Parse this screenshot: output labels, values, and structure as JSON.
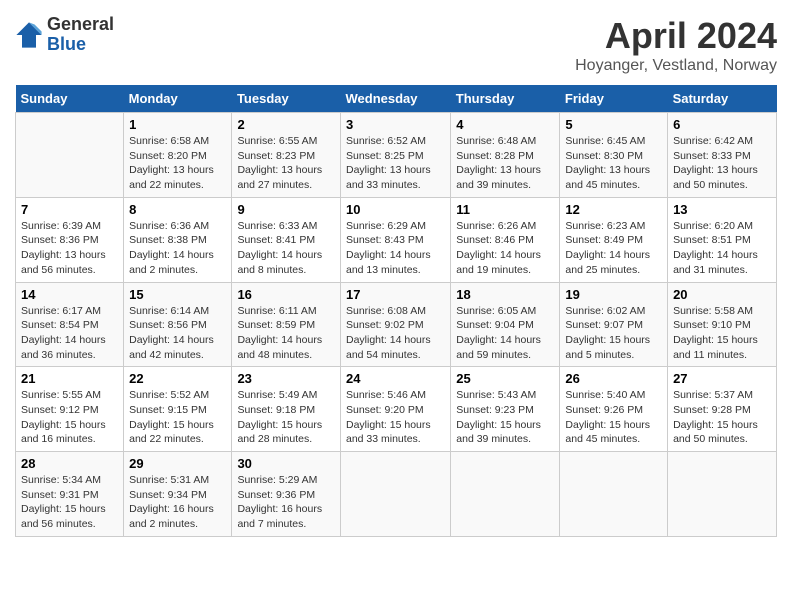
{
  "logo": {
    "general": "General",
    "blue": "Blue"
  },
  "title": "April 2024",
  "subtitle": "Hoyanger, Vestland, Norway",
  "days_header": [
    "Sunday",
    "Monday",
    "Tuesday",
    "Wednesday",
    "Thursday",
    "Friday",
    "Saturday"
  ],
  "weeks": [
    [
      {
        "day": "",
        "detail": ""
      },
      {
        "day": "1",
        "detail": "Sunrise: 6:58 AM\nSunset: 8:20 PM\nDaylight: 13 hours\nand 22 minutes."
      },
      {
        "day": "2",
        "detail": "Sunrise: 6:55 AM\nSunset: 8:23 PM\nDaylight: 13 hours\nand 27 minutes."
      },
      {
        "day": "3",
        "detail": "Sunrise: 6:52 AM\nSunset: 8:25 PM\nDaylight: 13 hours\nand 33 minutes."
      },
      {
        "day": "4",
        "detail": "Sunrise: 6:48 AM\nSunset: 8:28 PM\nDaylight: 13 hours\nand 39 minutes."
      },
      {
        "day": "5",
        "detail": "Sunrise: 6:45 AM\nSunset: 8:30 PM\nDaylight: 13 hours\nand 45 minutes."
      },
      {
        "day": "6",
        "detail": "Sunrise: 6:42 AM\nSunset: 8:33 PM\nDaylight: 13 hours\nand 50 minutes."
      }
    ],
    [
      {
        "day": "7",
        "detail": "Sunrise: 6:39 AM\nSunset: 8:36 PM\nDaylight: 13 hours\nand 56 minutes."
      },
      {
        "day": "8",
        "detail": "Sunrise: 6:36 AM\nSunset: 8:38 PM\nDaylight: 14 hours\nand 2 minutes."
      },
      {
        "day": "9",
        "detail": "Sunrise: 6:33 AM\nSunset: 8:41 PM\nDaylight: 14 hours\nand 8 minutes."
      },
      {
        "day": "10",
        "detail": "Sunrise: 6:29 AM\nSunset: 8:43 PM\nDaylight: 14 hours\nand 13 minutes."
      },
      {
        "day": "11",
        "detail": "Sunrise: 6:26 AM\nSunset: 8:46 PM\nDaylight: 14 hours\nand 19 minutes."
      },
      {
        "day": "12",
        "detail": "Sunrise: 6:23 AM\nSunset: 8:49 PM\nDaylight: 14 hours\nand 25 minutes."
      },
      {
        "day": "13",
        "detail": "Sunrise: 6:20 AM\nSunset: 8:51 PM\nDaylight: 14 hours\nand 31 minutes."
      }
    ],
    [
      {
        "day": "14",
        "detail": "Sunrise: 6:17 AM\nSunset: 8:54 PM\nDaylight: 14 hours\nand 36 minutes."
      },
      {
        "day": "15",
        "detail": "Sunrise: 6:14 AM\nSunset: 8:56 PM\nDaylight: 14 hours\nand 42 minutes."
      },
      {
        "day": "16",
        "detail": "Sunrise: 6:11 AM\nSunset: 8:59 PM\nDaylight: 14 hours\nand 48 minutes."
      },
      {
        "day": "17",
        "detail": "Sunrise: 6:08 AM\nSunset: 9:02 PM\nDaylight: 14 hours\nand 54 minutes."
      },
      {
        "day": "18",
        "detail": "Sunrise: 6:05 AM\nSunset: 9:04 PM\nDaylight: 14 hours\nand 59 minutes."
      },
      {
        "day": "19",
        "detail": "Sunrise: 6:02 AM\nSunset: 9:07 PM\nDaylight: 15 hours\nand 5 minutes."
      },
      {
        "day": "20",
        "detail": "Sunrise: 5:58 AM\nSunset: 9:10 PM\nDaylight: 15 hours\nand 11 minutes."
      }
    ],
    [
      {
        "day": "21",
        "detail": "Sunrise: 5:55 AM\nSunset: 9:12 PM\nDaylight: 15 hours\nand 16 minutes."
      },
      {
        "day": "22",
        "detail": "Sunrise: 5:52 AM\nSunset: 9:15 PM\nDaylight: 15 hours\nand 22 minutes."
      },
      {
        "day": "23",
        "detail": "Sunrise: 5:49 AM\nSunset: 9:18 PM\nDaylight: 15 hours\nand 28 minutes."
      },
      {
        "day": "24",
        "detail": "Sunrise: 5:46 AM\nSunset: 9:20 PM\nDaylight: 15 hours\nand 33 minutes."
      },
      {
        "day": "25",
        "detail": "Sunrise: 5:43 AM\nSunset: 9:23 PM\nDaylight: 15 hours\nand 39 minutes."
      },
      {
        "day": "26",
        "detail": "Sunrise: 5:40 AM\nSunset: 9:26 PM\nDaylight: 15 hours\nand 45 minutes."
      },
      {
        "day": "27",
        "detail": "Sunrise: 5:37 AM\nSunset: 9:28 PM\nDaylight: 15 hours\nand 50 minutes."
      }
    ],
    [
      {
        "day": "28",
        "detail": "Sunrise: 5:34 AM\nSunset: 9:31 PM\nDaylight: 15 hours\nand 56 minutes."
      },
      {
        "day": "29",
        "detail": "Sunrise: 5:31 AM\nSunset: 9:34 PM\nDaylight: 16 hours\nand 2 minutes."
      },
      {
        "day": "30",
        "detail": "Sunrise: 5:29 AM\nSunset: 9:36 PM\nDaylight: 16 hours\nand 7 minutes."
      },
      {
        "day": "",
        "detail": ""
      },
      {
        "day": "",
        "detail": ""
      },
      {
        "day": "",
        "detail": ""
      },
      {
        "day": "",
        "detail": ""
      }
    ]
  ]
}
